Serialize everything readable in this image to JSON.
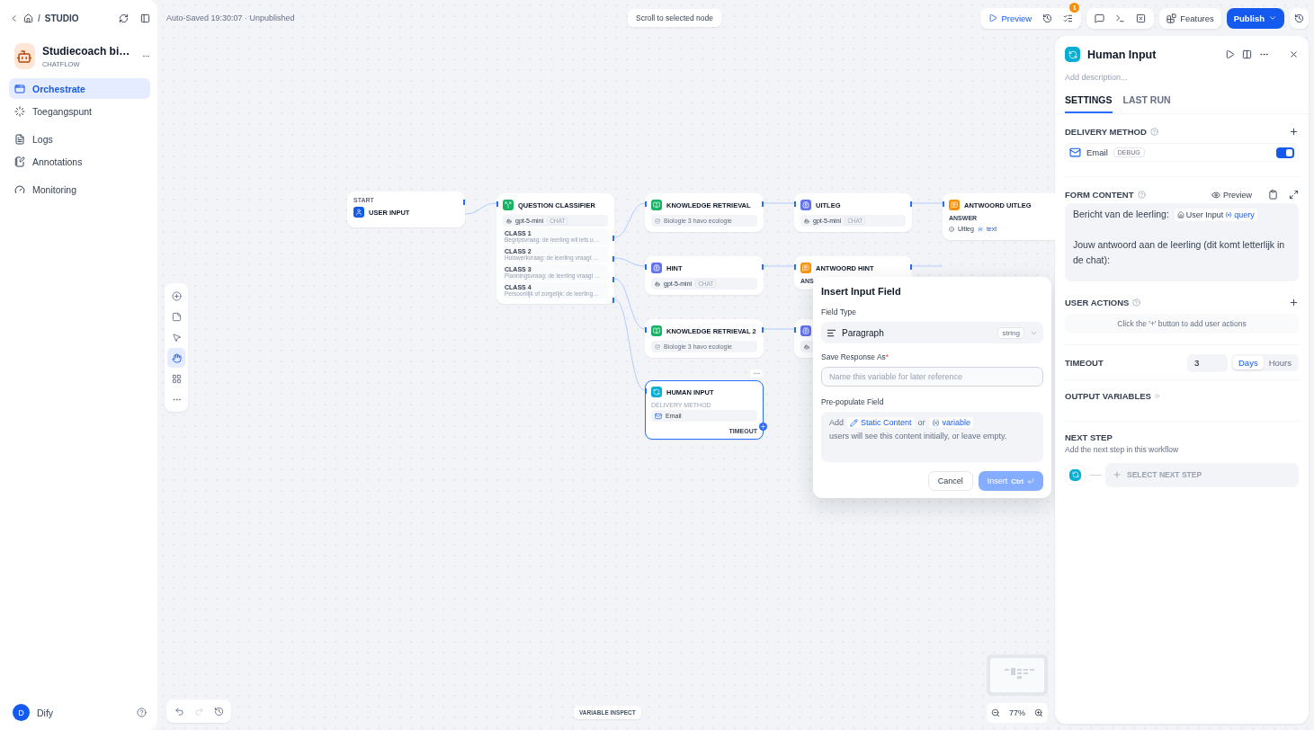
{
  "sidebar": {
    "breadcrumb_separator": "/",
    "breadcrumb": "STUDIO",
    "app": {
      "name": "Studiecoach bi…",
      "type": "CHATFLOW"
    },
    "nav": [
      {
        "label": "Orchestrate",
        "selected": true
      },
      {
        "label": "Toegangspunt",
        "selected": false
      },
      {
        "label": "Logs",
        "selected": false
      },
      {
        "label": "Annotations",
        "selected": false
      },
      {
        "label": "Monitoring",
        "selected": false
      }
    ],
    "user": {
      "initial": "D",
      "name": "Dify"
    }
  },
  "topbar": {
    "status": "Auto-Saved 19:30:07 · Unpublished",
    "scroll_hint": "Scroll to selected node",
    "preview": "Preview",
    "checklist_badge": "1",
    "features": "Features",
    "publish": "Publish"
  },
  "canvas": {
    "nodes": [
      {
        "kind": "start",
        "label": "START",
        "title": "USER INPUT",
        "selected": false
      },
      {
        "kind": "classifier",
        "title": "QUESTION CLASSIFIER",
        "model": "gpt-5-mini",
        "mode": "CHAT",
        "selected": false,
        "classes": [
          {
            "name": "CLASS 1",
            "text": "Begripsvraag: de leerling wil iets u…"
          },
          {
            "name": "CLASS 2",
            "text": "Huiswerkvraag: de leerling vraagt …"
          },
          {
            "name": "CLASS 3",
            "text": "Planningsvraag: de leerling vraagt …"
          },
          {
            "name": "CLASS 4",
            "text": "Persoonlijk of zorgelijk: de leerling…"
          }
        ]
      },
      {
        "kind": "retrieval",
        "title": "KNOWLEDGE RETRIEVAL",
        "dataset": "Biologie 3 havo ecologie",
        "selected": false
      },
      {
        "kind": "llm",
        "title": "UITLEG",
        "model": "gpt-5-mini",
        "mode": "CHAT",
        "selected": false
      },
      {
        "kind": "answer",
        "title": "ANTWOORD UITLEG",
        "label": "ANSWER",
        "source": "Uitleg",
        "variable": "text",
        "selected": false
      },
      {
        "kind": "llm",
        "title": "HINT",
        "model": "gpt-5-mini",
        "mode": "CHAT",
        "selected": false
      },
      {
        "kind": "answer",
        "title": "ANTWOORD HINT",
        "label": "ANS",
        "selected": false
      },
      {
        "kind": "retrieval",
        "title": "KNOWLEDGE RETRIEVAL 2",
        "dataset": "Biologie 3 havo ecologie",
        "selected": false
      },
      {
        "kind": "llm",
        "selected": false
      },
      {
        "kind": "human",
        "title": "HUMAN INPUT",
        "label": "DELIVERY METHOD",
        "method": "Email",
        "timeout": "TIMEOUT",
        "selected": true
      }
    ],
    "tools": [
      {
        "kind": "add",
        "selected": false
      },
      {
        "kind": "note",
        "selected": false
      },
      {
        "kind": "pointer",
        "selected": false
      },
      {
        "kind": "hand",
        "selected": true
      },
      {
        "kind": "layout",
        "selected": false
      },
      {
        "kind": "more",
        "selected": false
      }
    ],
    "variable_inspect": "VARIABLE INSPECT",
    "zoom": "77%"
  },
  "dialog": {
    "title": "Insert Input Field",
    "field_type_label": "Field Type",
    "field_type": "Paragraph",
    "field_type_tag": "string",
    "save_label": "Save Response As",
    "required_mark": "*",
    "save_placeholder": "Name this variable for later reference",
    "prepopulate_label": "Pre-populate Field",
    "prepopulate": {
      "add": "Add",
      "static_link": "Static Content",
      "or": "or",
      "variable_link": "variable",
      "hint": "users will see this content initially, or leave empty."
    },
    "cancel": "Cancel",
    "insert": {
      "label": "Insert",
      "shortcut": "Ctrl",
      "disabled": true
    }
  },
  "panel": {
    "title": "Human Input",
    "description_placeholder": "Add description...",
    "tabs": [
      {
        "label": "SETTINGS",
        "selected": true
      },
      {
        "label": "LAST RUN",
        "selected": false
      }
    ],
    "delivery": {
      "heading": "DELIVERY METHOD",
      "method": "Email",
      "tag": "DEBUG",
      "enabled": true
    },
    "form": {
      "heading": "FORM CONTENT",
      "preview": "Preview",
      "lines": [
        {
          "text": "Bericht van de leerling:",
          "chip": {
            "node": "User Input",
            "variable": "query"
          }
        },
        {
          "text": "Jouw antwoord aan de leerling (dit komt letterlijk in de chat):"
        }
      ]
    },
    "user_actions": {
      "heading": "USER ACTIONS",
      "empty": "Click the '+' button to add user actions"
    },
    "timeout": {
      "heading": "TIMEOUT",
      "value": "3",
      "units": [
        {
          "label": "Days",
          "selected": true
        },
        {
          "label": "Hours",
          "selected": false
        }
      ]
    },
    "output_variables": {
      "heading": "OUTPUT VARIABLES"
    },
    "next_step": {
      "heading": "NEXT STEP",
      "hint": "Add the next step in this workflow",
      "select": "SELECT NEXT STEP"
    }
  }
}
